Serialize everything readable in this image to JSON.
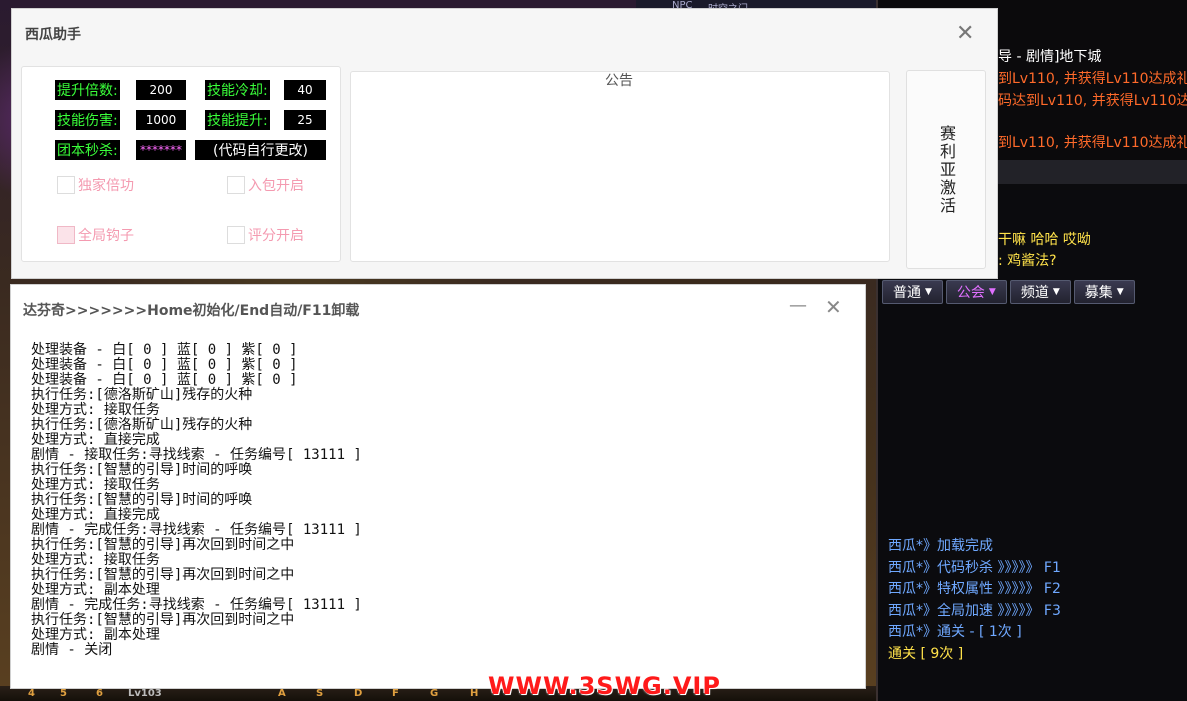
{
  "xigua": {
    "title": "西瓜助手",
    "fields": [
      {
        "label": "提升倍数:",
        "value": "200"
      },
      {
        "label": "技能冷却:",
        "value": "40"
      },
      {
        "label": "技能伤害:",
        "value": "1000"
      },
      {
        "label": "技能提升:",
        "value": "25"
      },
      {
        "label": "团本秒杀:",
        "value": "*******",
        "note": "(代码自行更改)"
      }
    ],
    "checkboxes": [
      {
        "label": "独家倍功"
      },
      {
        "label": "入包开启"
      },
      {
        "label": "全局钩子"
      },
      {
        "label": "评分开启"
      }
    ],
    "notice_title": "公告",
    "activate_label": "赛利亚激活"
  },
  "davinci": {
    "title": "达芬奇>>>>>>>Home初始化/End自动/F11卸载",
    "log": [
      "处理装备 - 白[ 0 ] 蓝[ 0 ] 紫[ 0 ]",
      "处理装备 - 白[ 0 ] 蓝[ 0 ] 紫[ 0 ]",
      "处理装备 - 白[ 0 ] 蓝[ 0 ] 紫[ 0 ]",
      "执行任务:[德洛斯矿山]残存的火种",
      "处理方式: 接取任务",
      "执行任务:[德洛斯矿山]残存的火种",
      "处理方式: 直接完成",
      "剧情 - 接取任务:寻找线索 - 任务编号[ 13111 ]",
      "执行任务:[智慧的引导]时间的呼唤",
      "处理方式: 接取任务",
      "执行任务:[智慧的引导]时间的呼唤",
      "处理方式: 直接完成",
      "剧情 - 完成任务:寻找线索 - 任务编号[ 13111 ]",
      "执行任务:[智慧的引导]再次回到时间之中",
      "处理方式: 接取任务",
      "执行任务:[智慧的引导]再次回到时间之中",
      "处理方式: 副本处理",
      "剧情 - 完成任务:寻找线索 - 任务编号[ 13111 ]",
      "执行任务:[智慧的引导]再次回到时间之中",
      "处理方式: 副本处理",
      "剧情 - 关闭"
    ]
  },
  "chat": {
    "top_lines": [
      {
        "text": "导 - 剧情]地下城",
        "color": "#ffffff"
      },
      {
        "text": "到Lv110, 并获得Lv110达成礼盒",
        "color": "#ff6a2a"
      },
      {
        "text": "码达到Lv110, 并获得Lv110达成",
        "color": "#ff6a2a"
      },
      {
        "text": "到Lv110, 并获得Lv110达成礼盒",
        "color": "#ff6a2a"
      }
    ],
    "mid_lines": [
      "干嘛 哈哈 哎呦",
      ": 鸡酱法?"
    ],
    "tabs": [
      {
        "label": "普通",
        "color": "#ffffff"
      },
      {
        "label": "公会",
        "color": "#e070ff"
      },
      {
        "label": "频道",
        "color": "#ffffff"
      },
      {
        "label": "募集",
        "color": "#ffffff"
      }
    ],
    "log": [
      "西瓜*》加载完成",
      "西瓜*》代码秒杀 》》》》》 F1",
      "西瓜*》特权属性 》》》》》 F2",
      "西瓜*》全局加速 》》》》》 F3",
      "西瓜*》通关 - [ 1次 ]",
      "通关 [ 9次 ]"
    ]
  },
  "game": {
    "npc_labels": [
      "NPC",
      "时空之门"
    ],
    "hotkeys": [
      "4",
      "5",
      "6",
      "Lv103",
      "A",
      "S",
      "D",
      "F",
      "G",
      "H"
    ],
    "watermark": "WWW.3SWG.VIP"
  }
}
